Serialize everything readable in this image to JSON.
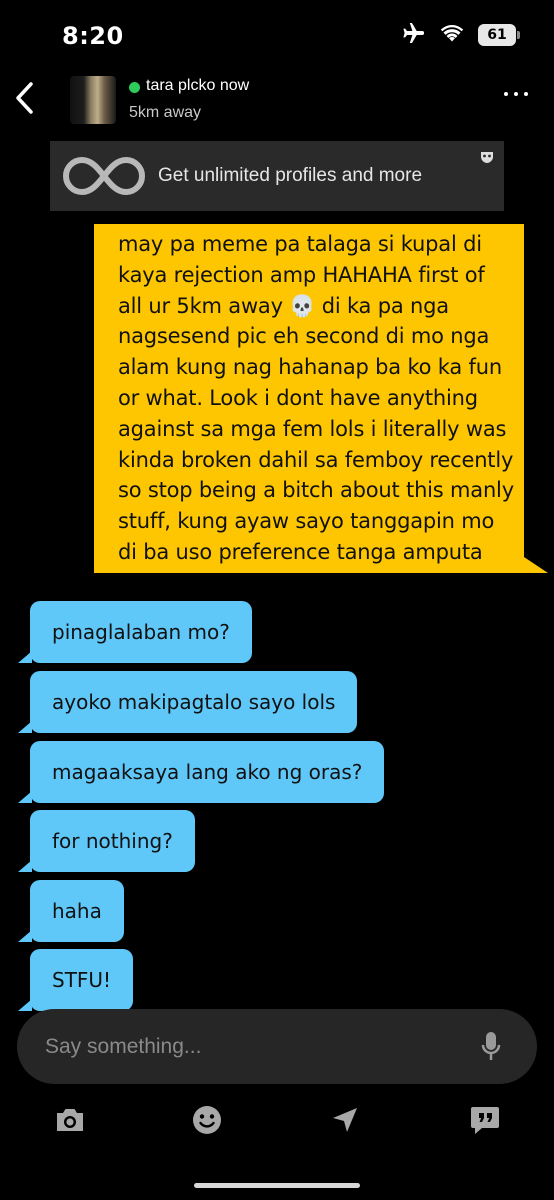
{
  "status_bar": {
    "time": "8:20",
    "battery": "61"
  },
  "header": {
    "contact_name": "tara plcko now",
    "distance": "5km away"
  },
  "banner": {
    "text": "Get unlimited profiles and more"
  },
  "messages": {
    "outgoing": "may pa meme pa talaga si kupal di kaya rejection amp HAHAHA first of all ur 5km away 💀 di ka pa nga nagsesend pic eh second di mo nga alam kung nag hahanap ba ko ka fun or what. Look i dont have anything against sa mga fem lols i literally was kinda broken dahil sa femboy recently so stop being a bitch about this manly stuff, kung ayaw sayo tanggapin mo di ba uso preference tanga amputa",
    "incoming": [
      "pinaglalaban mo?",
      "ayoko makipagtalo sayo lols",
      "magaaksaya lang ako ng oras?",
      "for nothing?",
      "haha",
      "STFU!"
    ]
  },
  "input": {
    "placeholder": "Say something..."
  },
  "colors": {
    "outgoing_bubble": "#fdc600",
    "incoming_bubble": "#5fc8f8",
    "online": "#2ecc5a"
  }
}
